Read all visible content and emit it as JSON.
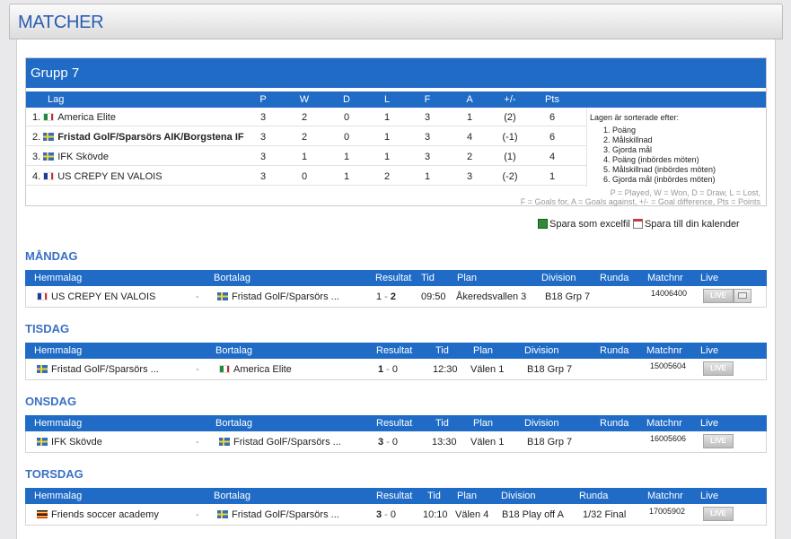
{
  "page": {
    "title": "MATCHER"
  },
  "group": {
    "title": "Grupp 7",
    "columns": {
      "team": "Lag",
      "p": "P",
      "w": "W",
      "d": "D",
      "l": "L",
      "f": "F",
      "a": "A",
      "diff": "+/-",
      "pts": "Pts"
    },
    "rows": [
      {
        "rank": "1.",
        "flag": "mx",
        "name": "America Elite",
        "p": "3",
        "w": "2",
        "d": "0",
        "l": "1",
        "f": "3",
        "a": "1",
        "diff": "(2)",
        "pts": "6",
        "bold": false
      },
      {
        "rank": "2.",
        "flag": "se",
        "name": "Fristad GolF/Sparsörs AIK/Borgstena IF",
        "p": "3",
        "w": "2",
        "d": "0",
        "l": "1",
        "f": "3",
        "a": "4",
        "diff": "(-1)",
        "pts": "6",
        "bold": true
      },
      {
        "rank": "3.",
        "flag": "se",
        "name": "IFK Skövde",
        "p": "3",
        "w": "1",
        "d": "1",
        "l": "1",
        "f": "3",
        "a": "2",
        "diff": "(1)",
        "pts": "4",
        "bold": false
      },
      {
        "rank": "4.",
        "flag": "fr",
        "name": "US CREPY EN VALOIS",
        "p": "3",
        "w": "0",
        "d": "1",
        "l": "2",
        "f": "1",
        "a": "3",
        "diff": "(-2)",
        "pts": "1",
        "bold": false
      }
    ],
    "sorting": {
      "title": "Lagen är sorterade efter:",
      "items": [
        "1. Poäng",
        "2. Målskillnad",
        "3. Gjorda mål",
        "4. Poäng (inbördes möten)",
        "5. Målskillnad (inbördes möten)",
        "6. Gjorda mål (inbördes möten)"
      ]
    },
    "legend": {
      "line1": "P = Played, W = Won, D = Draw, L = Lost,",
      "line2": "F = Goals for, A = Goals against, +/- = Goal difference, Pts = Points"
    }
  },
  "actions": {
    "excel": "Spara som excelfil",
    "calendar": "Spara till din kalender"
  },
  "match_columns": {
    "home": "Hemmalag",
    "away": "Bortalag",
    "result": "Resultat",
    "time": "Tid",
    "plan": "Plan",
    "division": "Division",
    "round": "Runda",
    "matchnr": "Matchnr",
    "live": "Live"
  },
  "days": [
    {
      "name": "MÅNDAG",
      "match": {
        "home": "US CREPY EN VALOIS",
        "home_flag": "fr",
        "sep": "-",
        "away": "Fristad GolF/Sparsörs ...",
        "away_flag": "se",
        "score_home": "1",
        "score_sep": " - ",
        "score_away": "2",
        "winner": "away",
        "time": "09:50",
        "plan": "Åkeredsvallen 3",
        "division": "B18 Grp 7",
        "round": "",
        "matchnr": "14006400",
        "live": "LIVE",
        "tv": true
      }
    },
    {
      "name": "TISDAG",
      "match": {
        "home": "Fristad GolF/Sparsörs ...",
        "home_flag": "se",
        "sep": "-",
        "away": "America Elite",
        "away_flag": "mx",
        "score_home": "1",
        "score_sep": " - ",
        "score_away": "0",
        "winner": "home",
        "time": "12:30",
        "plan": "Välen 1",
        "division": "B18 Grp 7",
        "round": "",
        "matchnr": "15005604",
        "live": "LIVE",
        "tv": false
      }
    },
    {
      "name": "ONSDAG",
      "match": {
        "home": "IFK Skövde",
        "home_flag": "se",
        "sep": "-",
        "away": "Fristad GolF/Sparsörs ...",
        "away_flag": "se",
        "score_home": "3",
        "score_sep": " - ",
        "score_away": "0",
        "winner": "home",
        "time": "13:30",
        "plan": "Välen 1",
        "division": "B18 Grp 7",
        "round": "",
        "matchnr": "16005606",
        "live": "LIVE",
        "tv": false
      }
    },
    {
      "name": "TORSDAG",
      "match": {
        "home": "Friends soccer academy",
        "home_flag": "ug",
        "sep": "-",
        "away": "Fristad GolF/Sparsörs ...",
        "away_flag": "se",
        "score_home": "3",
        "score_sep": " - ",
        "score_away": "0",
        "winner": "home",
        "time": "10:10",
        "plan": "Välen 4",
        "division": "B18 Play off A",
        "round": "1/32 Final",
        "matchnr": "17005902",
        "live": "LIVE",
        "tv": false
      }
    }
  ]
}
